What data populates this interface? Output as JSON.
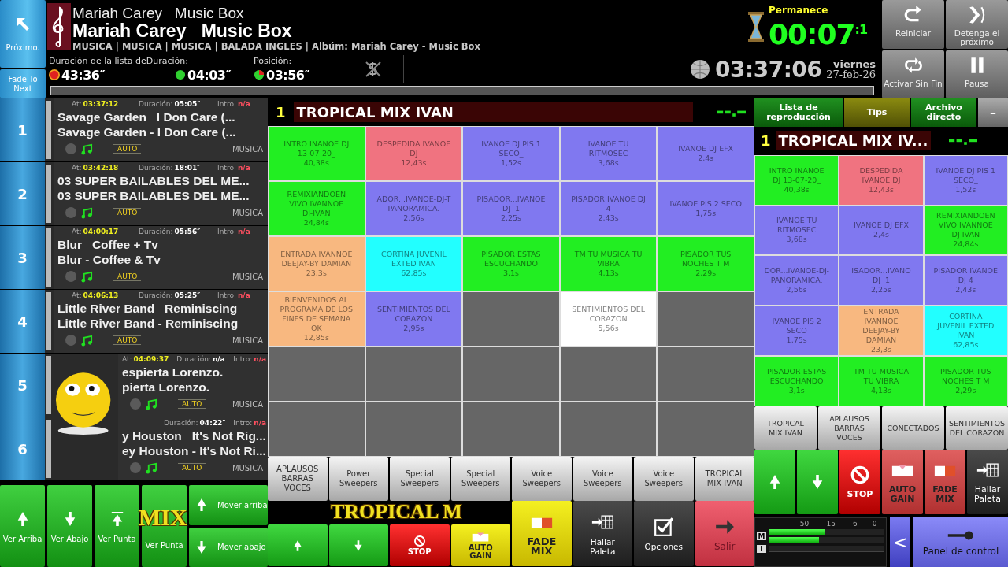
{
  "left_buttons": [
    {
      "label": "Próximo.",
      "kind": "next"
    },
    {
      "label": "Fade To Next",
      "kind": "fade"
    }
  ],
  "now_playing": {
    "line_1": "Mariah Carey   Music Box",
    "line_2": "Mariah Carey   Music Box",
    "info": "MUSICA | MUSICA | MUSICA | BALADA INGLES | Albúm: Mariah Carey - Music Box"
  },
  "timers": {
    "list_label": "Duración de la lista deDuración:",
    "list_value": "43:36″",
    "duration_value": "04:03″",
    "position_label": "Posición:",
    "position_value": "03:56″"
  },
  "remaining": {
    "label": "Permanece",
    "value": "00:07$^{:1}$"
  },
  "clock": {
    "time": "03:37:06",
    "day": "viernes",
    "date": "27-feb-26"
  },
  "top_buttons": [
    {
      "label": "Reiniciar",
      "kind": "restart"
    },
    {
      "label": "Detenga el próximo",
      "kind": "skip"
    },
    {
      "label": "Activar Sin Fin",
      "kind": "loop"
    },
    {
      "label": "Pausa",
      "kind": "pause"
    }
  ],
  "playlist": [
    {
      "number": "1",
      "at_label": "At:",
      "at": "03:37:12",
      "duration_label": "Duración:",
      "duration": "05:05″",
      "intro_label": "Intro:",
      "intro": "n/a",
      "title": "Savage Garden   I Don Care (...",
      "subtitle": "Savage Garden - I Don Care (...",
      "mode": "AUTO",
      "category": "MUSICA"
    },
    {
      "number": "2",
      "at_label": "At:",
      "at": "03:42:18",
      "duration_label": "Duración:",
      "duration": "18:01″",
      "intro_label": "Intro:",
      "intro": "n/a",
      "title": "03 SUPER BAILABLES DEL ME...",
      "subtitle": "03 SUPER BAILABLES DEL ME...",
      "mode": "AUTO",
      "category": "MUSICA"
    },
    {
      "number": "3",
      "at_label": "At:",
      "at": "04:00:17",
      "duration_label": "Duración:",
      "duration": "05:56″",
      "intro_label": "Intro:",
      "intro": "n/a",
      "title": "Blur   Coffee + Tv",
      "subtitle": "Blur - Coffee & Tv",
      "mode": "AUTO",
      "category": "MUSICA"
    },
    {
      "number": "4",
      "at_label": "At:",
      "at": "04:06:13",
      "duration_label": "Duración:",
      "duration": "05:25″",
      "intro_label": "Intro:",
      "intro": "n/a",
      "title": "Little River Band   Reminiscing",
      "subtitle": "Little River Band - Reminiscing",
      "mode": "AUTO",
      "category": "MUSICA"
    },
    {
      "number": "5",
      "at_label": "At:",
      "at": "04:09:37",
      "duration_label": "Duración:",
      "duration": "n/a",
      "intro_label": "Intro:",
      "intro": "n/a",
      "title": "espierta Lorenzo.",
      "subtitle": "pierta Lorenzo.",
      "mode": "AUTO",
      "category": "MUSICA"
    },
    {
      "number": "6",
      "duration_label": "Duración:",
      "duration": "04:22″",
      "intro_label": "Intro:",
      "intro": "n/a",
      "title": "y Houston   It's Not Rig...",
      "subtitle": "ey Houston - It's Not Ri...",
      "mode": "AUTO",
      "category": "MUSICA"
    }
  ],
  "left_controls": [
    {
      "label": "Ver Arriba",
      "kind": "up"
    },
    {
      "label": "Ver Abajo",
      "kind": "down"
    },
    {
      "label": "Ver Punta",
      "kind": "top"
    },
    {
      "label": "Ver Punta",
      "kind": "plain"
    }
  ],
  "move_buttons": [
    {
      "label": "Mover arriba",
      "kind": "up"
    },
    {
      "label": "Mover abajo",
      "kind": "down"
    }
  ],
  "ticker": {
    "left": "MIX",
    "center": "TROPICAL M"
  },
  "palette": {
    "number": "1",
    "title": "TROPICAL MIX IVAN"
  },
  "pads": [
    {
      "kind": "pad",
      "label": "INTRO INANOE DJ\n13-07-20_",
      "duration": "40,38s",
      "color": "#22ee22"
    },
    {
      "kind": "pad",
      "label": "DESPEDIDA IVANOE\nDJ",
      "duration": "12,43s",
      "color": "#f07380"
    },
    {
      "kind": "pad",
      "label": "IVANOE DJ PIS 1\nSECO_",
      "duration": "1,52s",
      "color": "#8078f0"
    },
    {
      "kind": "pad",
      "label": "IVANOE TU\nRITMOSEC",
      "duration": "3,68s",
      "color": "#8078f0"
    },
    {
      "kind": "pad",
      "label": "IVANOE DJ EFX",
      "duration": "2,4s",
      "color": "#8078f0"
    },
    {
      "kind": "pad",
      "label": "REMIXIANDOEN\nVIVO IVANNOE\nDJ-IVAN",
      "duration": "24,84s",
      "color": "#22ee22"
    },
    {
      "kind": "pad",
      "label": "ADOR...IVANOE-DJ-T\nPANORAMICA.",
      "duration": "2,56s",
      "color": "#8078f0"
    },
    {
      "kind": "pad",
      "label": "PISADOR...IVANOE\nDJ  1",
      "duration": "2,25s",
      "color": "#8078f0"
    },
    {
      "kind": "pad",
      "label": "PISADOR IVANOE DJ\n4",
      "duration": "2,43s",
      "color": "#8078f0"
    },
    {
      "kind": "pad",
      "label": "IVANOE PIS 2 SECO",
      "duration": "1,75s",
      "color": "#8078f0"
    },
    {
      "kind": "pad",
      "label": "ENTRADA IVANNOE\nDEEJAY-BY DAMIAN",
      "duration": "23,3s",
      "color": "#f8b880"
    },
    {
      "kind": "pad",
      "label": "CORTINA JUVENIL\nEXTED IVAN",
      "duration": "62,85s",
      "color": "#22ffff"
    },
    {
      "kind": "pad",
      "label": "PISADOR ESTAS\nESCUCHANDO",
      "duration": "3,1s",
      "color": "#22ee22"
    },
    {
      "kind": "pad",
      "label": "TM TU MUSICA TU\nVIBRA",
      "duration": "4,13s",
      "color": "#22ee22"
    },
    {
      "kind": "pad",
      "label": "PISADOR TUS\nNOCHES T M",
      "duration": "2,29s",
      "color": "#22ee22"
    },
    {
      "kind": "pad",
      "label": "BIENVENIDOS AL\nPROGRAMA DE LOS\nFINES DE SEMANA\nOK",
      "duration": "12,85s",
      "color": "#f8b880"
    },
    {
      "kind": "pad",
      "label": "SENTIMIENTOS DEL\nCORAZON",
      "duration": "2,95s",
      "color": "#8078f0"
    },
    {
      "kind": "empty"
    },
    {
      "kind": "pad",
      "label": "SENTIMIENTOS DEL\nCORAZON",
      "duration": "5,56s",
      "color": "#ffffff"
    },
    {
      "kind": "empty"
    },
    {
      "kind": "empty"
    },
    {
      "kind": "empty"
    },
    {
      "kind": "empty"
    },
    {
      "kind": "empty"
    },
    {
      "kind": "empty"
    },
    {
      "kind": "empty"
    },
    {
      "kind": "empty"
    },
    {
      "kind": "empty"
    },
    {
      "kind": "empty"
    },
    {
      "kind": "empty"
    }
  ],
  "categories": [
    "APLAUSOS\nBARRAS\nVOCES",
    "Power\nSweepers",
    "Special\nSweepers",
    "Special\nSweepers",
    "Voice\nSweepers",
    "Voice\nSweepers",
    "Voice\nSweepers",
    "TROPICAL\nMIX IVAN"
  ],
  "controls": [
    {
      "kind": "up"
    },
    {
      "kind": "down"
    },
    {
      "label": "STOP",
      "kind": "stop"
    },
    {
      "label": "AUTO\nGAIN",
      "kind": "autogain"
    },
    {
      "label": "FADE\nMIX",
      "kind": "fademix"
    },
    {
      "label": "Hallar\nPaleta",
      "kind": "palette"
    },
    {
      "label": "Opciones",
      "kind": "options"
    },
    {
      "label": "Salir",
      "kind": "exit"
    }
  ],
  "side_tabs": [
    {
      "label": "Lista de\nreproducción",
      "selected": false
    },
    {
      "label": "Tips",
      "selected": true
    },
    {
      "label": "Archivo\ndirecto",
      "selected": false
    }
  ],
  "side_minimize": "–",
  "side_palette": {
    "number": "1",
    "title": "TROPICAL MIX IV..."
  },
  "side_pads": [
    {
      "label": "INTRO INANOE\nDJ 13-07-20_",
      "duration": "40,38s",
      "color": "#22ee22"
    },
    {
      "label": "DESPEDIDA\nIVANOE DJ",
      "duration": "12,43s",
      "color": "#f07380"
    },
    {
      "label": "IVANOE DJ PIS 1\nSECO_",
      "duration": "1,52s",
      "color": "#8078f0"
    },
    {
      "label": "IVANOE TU\nRITMOSEC",
      "duration": "3,68s",
      "color": "#8078f0"
    },
    {
      "label": "IVANOE DJ EFX",
      "duration": "2,4s",
      "color": "#8078f0"
    },
    {
      "label": "REMIXIANDOEN\nVIVO IVANNOE\nDJ-IVAN",
      "duration": "24,84s",
      "color": "#22ee22"
    },
    {
      "label": "DOR...IVANOE-DJ-\nPANORAMICA.",
      "duration": "2,56s",
      "color": "#8078f0"
    },
    {
      "label": "ISADOR...IVANO\nDJ  1",
      "duration": "2,25s",
      "color": "#8078f0"
    },
    {
      "label": "PISADOR IVANOE\nDJ 4",
      "duration": "2,43s",
      "color": "#8078f0"
    },
    {
      "label": "IVANOE PIS 2\nSECO",
      "duration": "1,75s",
      "color": "#8078f0"
    },
    {
      "label": "ENTRADA\nIVANNOE\nDEEJAY-BY\nDAMIAN",
      "duration": "23,3s",
      "color": "#f8b880"
    },
    {
      "label": "CORTINA\nJUVENIL EXTED\nIVAN",
      "duration": "62,85s",
      "color": "#22ffff"
    },
    {
      "label": "PISADOR ESTAS\nESCUCHANDO",
      "duration": "3,1s",
      "color": "#22ee22"
    },
    {
      "label": "TM TU MUSICA\nTU VIBRA",
      "duration": "4,13s",
      "color": "#22ee22"
    },
    {
      "label": "PISADOR TUS\nNOCHES T M",
      "duration": "2,29s",
      "color": "#22ee22"
    }
  ],
  "side_categories": [
    "TROPICAL\nMIX IVAN",
    "APLAUSOS\nBARRAS\nVOCES",
    "CONECTADOS",
    "SENTIMIENTOS\nDEL CORAZON"
  ],
  "side_controls": [
    {
      "kind": "up"
    },
    {
      "kind": "down"
    },
    {
      "label": "STOP",
      "kind": "stop"
    },
    {
      "label": "AUTO\nGAIN",
      "kind": "autogain-alt"
    },
    {
      "label": "FADE\nMIX",
      "kind": "fademix-alt"
    },
    {
      "label": "Hallar\nPaleta",
      "kind": "palette"
    }
  ],
  "meter": {
    "scale": [
      "-",
      "-50",
      "-15",
      "-6",
      "0"
    ],
    "channels": [
      {
        "label": "M",
        "bars": [
          {
            "level": 0.48
          },
          {
            "level": 0.43
          }
        ]
      },
      {
        "label": "I"
      }
    ]
  },
  "back_button": "<",
  "panel_button": "Panel de control"
}
